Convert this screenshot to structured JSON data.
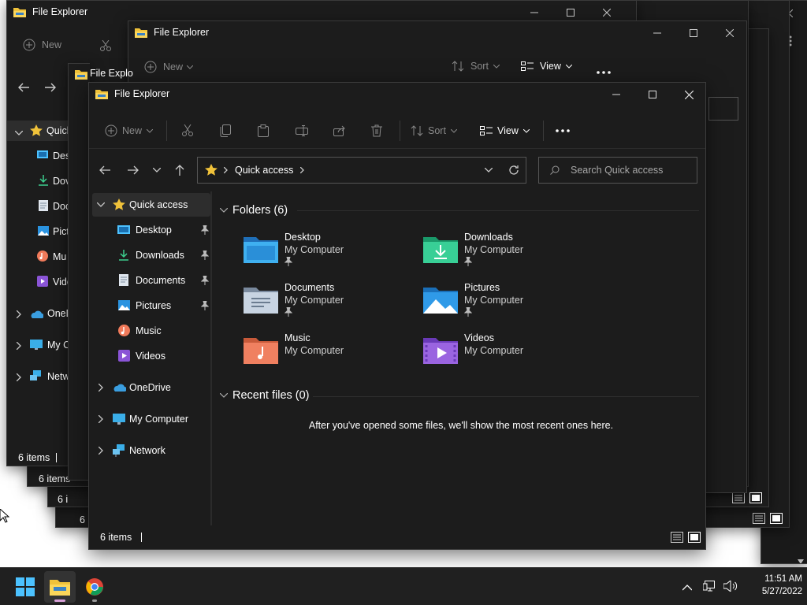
{
  "window": {
    "title": "File Explorer",
    "controls": {
      "minimize": "minimize-icon",
      "maximize": "maximize-icon",
      "close": "close-icon"
    }
  },
  "toolbar": {
    "new_label": "New",
    "sort_label": "Sort",
    "view_label": "View",
    "more_label": "See more"
  },
  "address": {
    "location": "Quick access"
  },
  "search": {
    "placeholder": "Search Quick access"
  },
  "sidebar": {
    "quick_access": "Quick access",
    "pinned": [
      "Desktop",
      "Downloads",
      "Documents",
      "Pictures"
    ],
    "others": [
      "Music",
      "Videos"
    ],
    "onedrive": "OneDrive",
    "my_computer": "My Computer",
    "network": "Network"
  },
  "main": {
    "folders_header": "Folders (6)",
    "folders": [
      {
        "name": "Desktop",
        "location": "My Computer",
        "pinned": true,
        "icon": "desktop-folder-icon"
      },
      {
        "name": "Downloads",
        "location": "My Computer",
        "pinned": true,
        "icon": "downloads-folder-icon"
      },
      {
        "name": "Documents",
        "location": "My Computer",
        "pinned": true,
        "icon": "documents-folder-icon"
      },
      {
        "name": "Pictures",
        "location": "My Computer",
        "pinned": true,
        "icon": "pictures-folder-icon"
      },
      {
        "name": "Music",
        "location": "My Computer",
        "pinned": false,
        "icon": "music-folder-icon"
      },
      {
        "name": "Videos",
        "location": "My Computer",
        "pinned": false,
        "icon": "videos-folder-icon"
      }
    ],
    "recent_header": "Recent files (0)",
    "recent_empty": "After you've opened some files, we'll show the most recent ones here."
  },
  "status": {
    "count": "6 items"
  },
  "background_windows": {
    "title_full": "File Explorer",
    "title_clipped": "File Explo",
    "nav_labels": [
      "Quick",
      "Des",
      "Dov",
      "Doc",
      "Pict",
      "Mu",
      "Vide",
      "OneD",
      "My C",
      "Netw"
    ],
    "status_clipped": "6 i"
  },
  "taskbar": {
    "time": "11:51 AM",
    "date": "5/27/2022",
    "apps": [
      "start-icon",
      "file-explorer-icon",
      "chrome-icon"
    ]
  },
  "colors": {
    "window_bg": "#1c1c1c",
    "accent_blue": "#4cc2ff",
    "folder_yellow": "#f0c23a"
  }
}
